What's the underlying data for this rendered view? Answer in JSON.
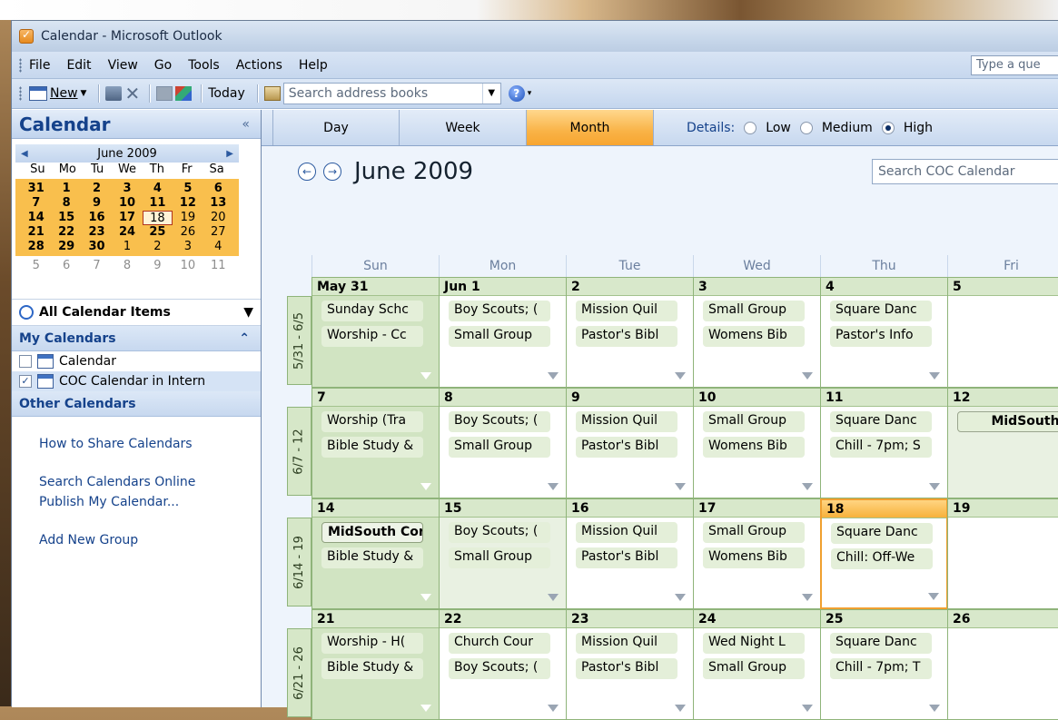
{
  "window": {
    "title": "Calendar - Microsoft Outlook"
  },
  "menu": {
    "items": [
      "File",
      "Edit",
      "View",
      "Go",
      "Tools",
      "Actions",
      "Help"
    ],
    "help_search": "Type a que"
  },
  "toolbar": {
    "new_label": "New",
    "today_label": "Today",
    "address_search": "Search address books"
  },
  "nav": {
    "title": "Calendar",
    "collapse": "«",
    "mini": {
      "month": "June 2009",
      "dow": [
        "Su",
        "Mo",
        "Tu",
        "We",
        "Th",
        "Fr",
        "Sa"
      ],
      "weeks": [
        [
          "31",
          "1",
          "2",
          "3",
          "4",
          "5",
          "6"
        ],
        [
          "7",
          "8",
          "9",
          "10",
          "11",
          "12",
          "13"
        ],
        [
          "14",
          "15",
          "16",
          "17",
          "18",
          "19",
          "20"
        ],
        [
          "21",
          "22",
          "23",
          "24",
          "25",
          "26",
          "27"
        ],
        [
          "28",
          "29",
          "30",
          "1",
          "2",
          "3",
          "4"
        ]
      ],
      "after": [
        "5",
        "6",
        "7",
        "8",
        "9",
        "10",
        "11"
      ],
      "today": "18"
    },
    "all_items": "All Calendar Items",
    "my_calendars": "My Calendars",
    "calendars": [
      {
        "name": "Calendar",
        "checked": false
      },
      {
        "name": "COC Calendar in Intern",
        "checked": true
      }
    ],
    "other_calendars": "Other Calendars",
    "links": [
      "How to Share Calendars",
      "Search Calendars Online",
      "Publish My Calendar...",
      "Add New Group"
    ]
  },
  "views": {
    "tabs": [
      "Day",
      "Week",
      "Month"
    ],
    "active": "Month",
    "details_label": "Details:",
    "options": [
      "Low",
      "Medium",
      "High"
    ],
    "selected": "High"
  },
  "month": {
    "title": "June 2009",
    "search_placeholder": "Search COC Calendar",
    "dow": [
      "Sun",
      "Mon",
      "Tue",
      "Wed",
      "Thu",
      "Fri"
    ]
  },
  "weeks": [
    {
      "label": "5/31 - 6/5",
      "days": [
        {
          "date": "May 31",
          "items": [
            "Sunday Schc",
            "Worship - Cc"
          ]
        },
        {
          "date": "Jun 1",
          "items": [
            "Boy Scouts; (",
            "Small Group"
          ]
        },
        {
          "date": "2",
          "items": [
            "Mission Quil",
            "Pastor's Bibl"
          ]
        },
        {
          "date": "3",
          "items": [
            "Small Group",
            "Womens Bib"
          ]
        },
        {
          "date": "4",
          "items": [
            "Square Danc",
            "Pastor's Info"
          ]
        },
        {
          "date": "5",
          "items": []
        }
      ]
    },
    {
      "label": "6/7 - 12",
      "days": [
        {
          "date": "7",
          "items": [
            "Worship (Tra",
            "Bible Study &"
          ]
        },
        {
          "date": "8",
          "items": [
            "Boy Scouts; (",
            "Small Group"
          ]
        },
        {
          "date": "9",
          "items": [
            "Mission Quil",
            "Pastor's Bibl"
          ]
        },
        {
          "date": "10",
          "items": [
            "Small Group",
            "Womens Bib"
          ]
        },
        {
          "date": "11",
          "items": [
            "Square Danc",
            "Chill - 7pm; S"
          ]
        },
        {
          "date": "12",
          "items": [
            "MidSouth"
          ]
        }
      ]
    },
    {
      "label": "6/14 - 19",
      "days": [
        {
          "date": "14",
          "items": [
            "MidSouth Cor",
            "Bible Study &"
          ]
        },
        {
          "date": "15",
          "items": [
            "Boy Scouts; (",
            "Small Group"
          ]
        },
        {
          "date": "16",
          "items": [
            "Mission Quil",
            "Pastor's Bibl"
          ]
        },
        {
          "date": "17",
          "items": [
            "Small Group",
            "Womens Bib"
          ]
        },
        {
          "date": "18",
          "items": [
            "Square Danc",
            "Chill: Off-We"
          ]
        },
        {
          "date": "19",
          "items": []
        }
      ]
    },
    {
      "label": "6/21 - 26",
      "days": [
        {
          "date": "21",
          "items": [
            "Worship - H(",
            "Bible Study &"
          ]
        },
        {
          "date": "22",
          "items": [
            "Church Cour",
            "Boy Scouts; ("
          ]
        },
        {
          "date": "23",
          "items": [
            "Mission Quil",
            "Pastor's Bibl"
          ]
        },
        {
          "date": "24",
          "items": [
            "Wed Night L",
            "Small Group"
          ]
        },
        {
          "date": "25",
          "items": [
            "Square Danc",
            "Chill - 7pm; T"
          ]
        },
        {
          "date": "26",
          "items": []
        }
      ]
    }
  ]
}
